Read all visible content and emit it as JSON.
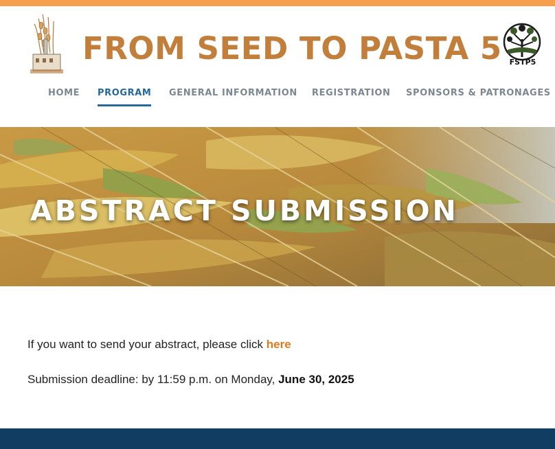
{
  "header": {
    "title": "FROM SEED TO PASTA 5",
    "logo_right_text": "FSTP5"
  },
  "nav": {
    "items": [
      {
        "label": "HOME",
        "active": false
      },
      {
        "label": "PROGRAM",
        "active": true
      },
      {
        "label": "GENERAL INFORMATION",
        "active": false
      },
      {
        "label": "REGISTRATION",
        "active": false
      },
      {
        "label": "SPONSORS & PATRONAGES",
        "active": false
      }
    ]
  },
  "hero": {
    "title": "ABSTRACT SUBMISSION"
  },
  "content": {
    "line1_text": "If you want to send your abstract, please click ",
    "line1_link": "here",
    "line2_text": "Submission deadline: by 11:59 p.m. on Monday, ",
    "line2_date": "June 30, 2025"
  },
  "colors": {
    "top_strip": "#f5a04d",
    "title": "#c27e3b",
    "nav_default": "#7d8790",
    "nav_active": "#23689b",
    "link": "#e07a1f",
    "footer_bar": "#103d61"
  },
  "icons": {
    "logo_left": "wheat-and-factory-logo-icon",
    "logo_right": "tree-globe-logo-icon"
  }
}
